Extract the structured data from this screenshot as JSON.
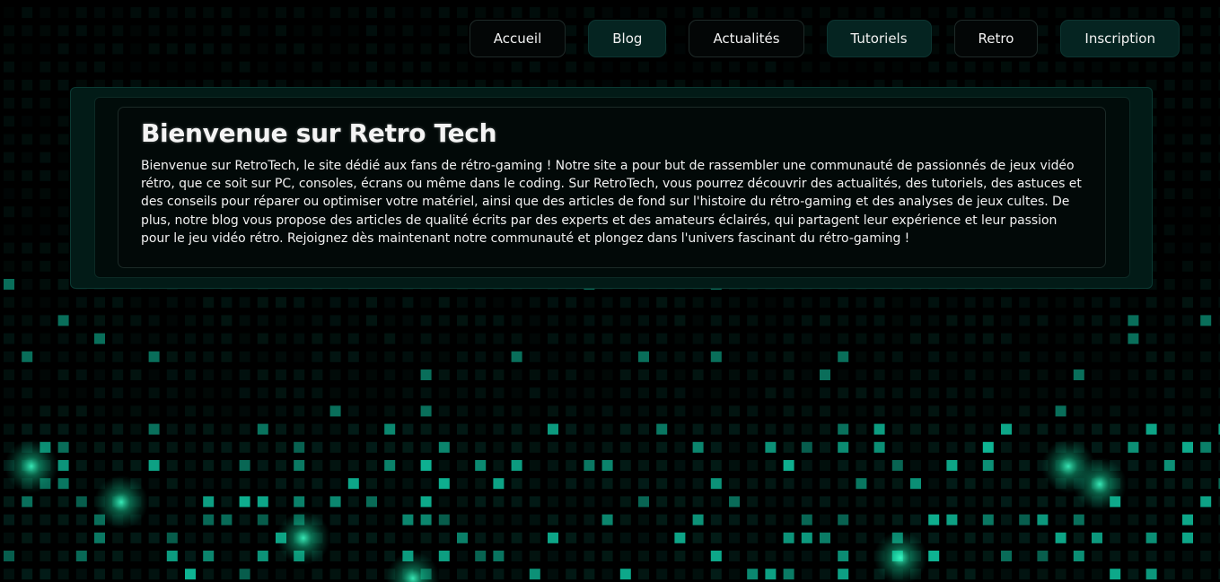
{
  "nav": {
    "items": [
      {
        "label": "Accueil",
        "style": "plain"
      },
      {
        "label": "Blog",
        "style": "alt"
      },
      {
        "label": "Actualités",
        "style": "plain"
      },
      {
        "label": "Tutoriels",
        "style": "alt"
      },
      {
        "label": "Retro",
        "style": "plain"
      },
      {
        "label": "Inscription",
        "style": "alt"
      }
    ]
  },
  "main": {
    "title": "Bienvenue sur Retro Tech",
    "body": "Bienvenue sur RetroTech, le site dédié aux fans de rétro-gaming ! Notre site a pour but de rassembler une communauté de passionnés de jeux vidéo rétro, que ce soit sur PC, consoles, écrans ou même dans le coding. Sur RetroTech, vous pourrez découvrir des actualités, des tutoriels, des astuces et des conseils pour réparer ou optimiser votre matériel, ainsi que des articles de fond sur l'histoire du rétro-gaming et des analyses de jeux cultes. De plus, notre blog vous propose des articles de qualité écrits par des experts et des amateurs éclairés, qui partagent leur expérience et leur passion pour le jeu vidéo rétro. Rejoignez dès maintenant notre communauté et plongez dans l'univers fascinant du rétro-gaming !"
  },
  "colors": {
    "background": "#000000",
    "accent": "#00c8a8",
    "card": "#020908"
  }
}
